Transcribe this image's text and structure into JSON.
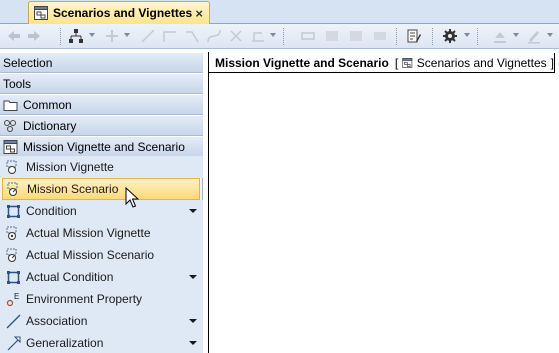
{
  "tab": {
    "title": "Scenarios and Vignettes",
    "close": "×",
    "icon": "diagram-icon"
  },
  "toolbar": {
    "icons": [
      "back-arrow-icon",
      "forward-arrow-icon",
      "layout-tree-icon",
      "align-icon",
      "path-straight-icon",
      "path-rectilinear-icon",
      "path-oblique-icon",
      "path-bezier-icon",
      "path-reset-icon",
      "path-style-icon",
      "arrange-icon",
      "shape-rect-icon",
      "shape-fill-icon",
      "shape-fill-2-icon",
      "properties-icon",
      "gear-icon",
      "fill-color-icon",
      "line-color-icon"
    ]
  },
  "palette": {
    "headers": [
      {
        "label": "Selection"
      },
      {
        "label": "Tools"
      },
      {
        "label": "Common",
        "icon": "folder-icon"
      },
      {
        "label": "Dictionary",
        "icon": "dictionary-icon"
      },
      {
        "label": "Mission Vignette and Scenario",
        "icon": "diagram-icon"
      }
    ],
    "items": [
      {
        "label": "Mission Vignette",
        "icon": "mission-vignette-icon",
        "has_more": false,
        "selected": false
      },
      {
        "label": "Mission Scenario",
        "icon": "mission-scenario-icon",
        "has_more": false,
        "selected": true
      },
      {
        "label": "Condition",
        "icon": "condition-icon",
        "has_more": true,
        "selected": false
      },
      {
        "label": "Actual Mission Vignette",
        "icon": "actual-mission-vignette-icon",
        "has_more": false,
        "selected": false
      },
      {
        "label": "Actual Mission Scenario",
        "icon": "actual-mission-scenario-icon",
        "has_more": false,
        "selected": false
      },
      {
        "label": "Actual Condition",
        "icon": "actual-condition-icon",
        "has_more": true,
        "selected": false
      },
      {
        "label": "Environment Property",
        "icon": "environment-property-icon",
        "has_more": false,
        "selected": false
      },
      {
        "label": "Association",
        "icon": "association-icon",
        "has_more": true,
        "selected": false
      },
      {
        "label": "Generalization",
        "icon": "generalization-icon",
        "has_more": true,
        "selected": false
      }
    ]
  },
  "diagram": {
    "frame_name": "Mission Vignette and Scenario",
    "open_bracket": "[",
    "diagram_type": "Scenarios and Vignettes",
    "close_bracket": "]"
  },
  "colors": {
    "tab_active": "#ffe48a",
    "palette_header": "#c7d6ea",
    "palette_item": "#dfe9f6",
    "selected_item": "#ffd97a"
  }
}
